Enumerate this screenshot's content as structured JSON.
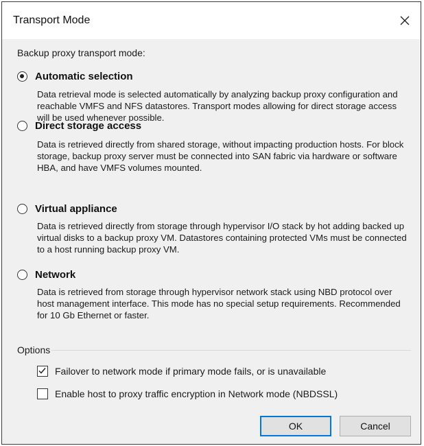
{
  "dialog": {
    "title": "Transport Mode",
    "close_icon": "close-icon"
  },
  "heading": "Backup proxy transport mode:",
  "modes": [
    {
      "label": "Automatic selection",
      "selected": true,
      "description": "Data retrieval mode is selected automatically by analyzing backup proxy configuration and reachable VMFS and NFS datastores. Transport modes allowing for direct storage access will be used whenever possible."
    },
    {
      "label": "Direct storage access",
      "selected": false,
      "description": "Data is retrieved directly from shared storage, without impacting production hosts. For block storage, backup proxy server must be connected into SAN fabric via hardware or software HBA, and have VMFS volumes mounted."
    },
    {
      "label": "Virtual appliance",
      "selected": false,
      "description": "Data is retrieved directly from storage through hypervisor I/O stack by hot adding backed up virtual disks to a backup proxy VM. Datastores containing protected VMs must be connected to a host running backup proxy VM."
    },
    {
      "label": "Network",
      "selected": false,
      "description": "Data is retrieved from storage through hypervisor network stack using NBD protocol over host management interface. This mode has no special setup requirements. Recommended for 10 Gb Ethernet or faster."
    }
  ],
  "options": {
    "label": "Options",
    "failover": {
      "label": "Failover to network mode if primary mode fails, or is unavailable",
      "checked": true
    },
    "encryption": {
      "label": "Enable host to proxy traffic encryption in Network mode (NBDSSL)",
      "checked": false
    }
  },
  "buttons": {
    "ok_label": "OK",
    "cancel_label": "Cancel"
  },
  "colors": {
    "accent": "#0078d7",
    "panel_bg": "#f0f0f0"
  }
}
